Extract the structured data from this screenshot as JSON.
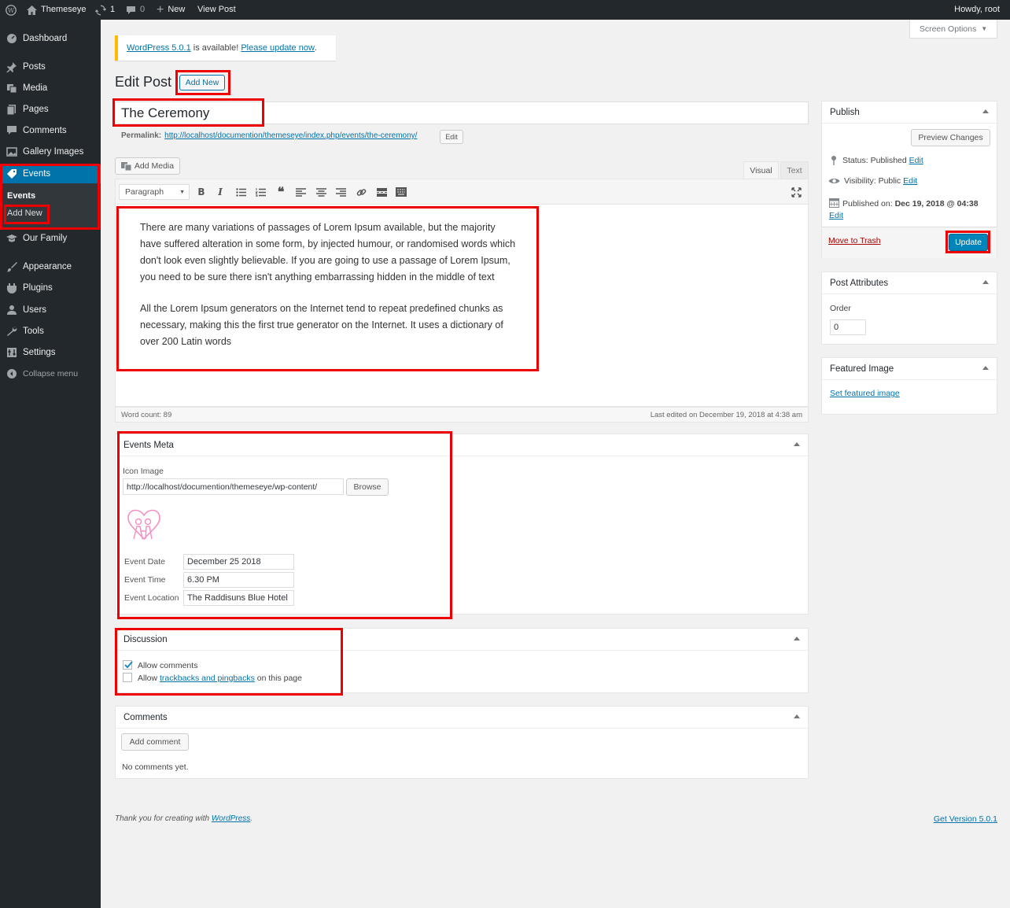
{
  "adminbar": {
    "site_name": "Themeseye",
    "updates_count": "1",
    "comments_count": "0",
    "new_label": "New",
    "view_post": "View Post",
    "howdy": "Howdy, root"
  },
  "sidebar": {
    "items": [
      {
        "label": "Dashboard",
        "icon": "dashboard-icon"
      },
      {
        "label": "Posts",
        "icon": "pin-icon"
      },
      {
        "label": "Media",
        "icon": "media-icon"
      },
      {
        "label": "Pages",
        "icon": "pages-icon"
      },
      {
        "label": "Comments",
        "icon": "comment-icon"
      },
      {
        "label": "Gallery Images",
        "icon": "gallery-icon"
      },
      {
        "label": "Events",
        "icon": "tag-icon"
      },
      {
        "label": "Our Family",
        "icon": "graduation-cap-icon"
      },
      {
        "label": "Appearance",
        "icon": "brush-icon"
      },
      {
        "label": "Plugins",
        "icon": "plug-icon"
      },
      {
        "label": "Users",
        "icon": "user-icon"
      },
      {
        "label": "Tools",
        "icon": "wrench-icon"
      },
      {
        "label": "Settings",
        "icon": "settings-icon"
      },
      {
        "label": "Collapse menu",
        "icon": "collapse-icon"
      }
    ],
    "submenu": {
      "events": "Events",
      "add_new": "Add New"
    }
  },
  "screen_options": "Screen Options",
  "notice": {
    "version_link": "WordPress 5.0.1",
    "mid": " is available! ",
    "update_link": "Please update now",
    "end": "."
  },
  "page": {
    "title": "Edit Post",
    "add_new": "Add New"
  },
  "post": {
    "title": "The Ceremony",
    "permalink_label": "Permalink:",
    "permalink_base": "http://localhost/documention/themeseye/index.php/events/",
    "permalink_slug": "the-ceremony",
    "permalink_end": "/",
    "edit_label": "Edit"
  },
  "editor": {
    "add_media": "Add Media",
    "tab_visual": "Visual",
    "tab_text": "Text",
    "format": "Paragraph",
    "paragraph1": "There are many variations of passages of Lorem Ipsum available, but the majority have suffered alteration in some form, by injected humour, or randomised words which don't look even slightly believable. If you are going to use a passage of Lorem Ipsum, you need to be sure there isn't anything embarrassing hidden in the middle of text",
    "paragraph2": "All the Lorem Ipsum generators on the Internet tend to repeat predefined chunks as necessary, making this the first true generator on the Internet. It uses a dictionary of over 200 Latin words",
    "word_count": "Word count: 89",
    "last_edited": "Last edited on December 19, 2018 at 4:38 am"
  },
  "events_meta": {
    "title": "Events Meta",
    "icon_image_label": "Icon Image",
    "icon_image_value": "http://localhost/documention/themeseye/wp-content/",
    "browse": "Browse",
    "date_label": "Event Date",
    "date_value": "December 25 2018",
    "time_label": "Event Time",
    "time_value": "6.30 PM",
    "location_label": "Event Location",
    "location_value": "The Raddisuns Blue Hotel"
  },
  "discussion": {
    "title": "Discussion",
    "allow_comments": "Allow comments",
    "allow_pre": "Allow ",
    "trackbacks_link": "trackbacks and pingbacks",
    "allow_post": " on this page"
  },
  "comments": {
    "title": "Comments",
    "add_comment": "Add comment",
    "empty": "No comments yet."
  },
  "publish": {
    "title": "Publish",
    "preview": "Preview Changes",
    "status_label": "Status: ",
    "status_value": "Published",
    "visibility_label": "Visibility: ",
    "visibility_value": "Public",
    "published_label": "Published on: ",
    "published_value": "Dec 19, 2018 @ 04:38",
    "edit": "Edit",
    "trash": "Move to Trash",
    "update": "Update"
  },
  "post_attributes": {
    "title": "Post Attributes",
    "order_label": "Order",
    "order_value": "0"
  },
  "featured_image": {
    "title": "Featured Image",
    "set_link": "Set featured image"
  },
  "footer": {
    "thanks_pre": "Thank you for creating with ",
    "wp_link": "WordPress",
    "thanks_end": ".",
    "version": "Get Version 5.0.1"
  },
  "colors": {
    "highlight": "#e00000",
    "accent": "#0073aa",
    "sidebar": "#23282d"
  }
}
